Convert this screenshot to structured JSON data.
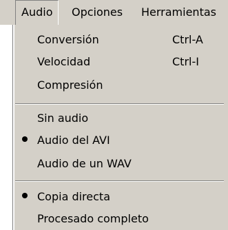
{
  "menubar": {
    "items": [
      {
        "label": "Audio",
        "active": true
      },
      {
        "label": "Opciones",
        "active": false
      },
      {
        "label": "Herramientas",
        "active": false
      }
    ]
  },
  "menu": {
    "conversion": {
      "label": "Conversión",
      "shortcut": "Ctrl-A"
    },
    "velocidad": {
      "label": "Velocidad",
      "shortcut": "Ctrl-I"
    },
    "compresion": {
      "label": "Compresión"
    },
    "sin_audio": {
      "label": "Sin audio",
      "checked": false
    },
    "audio_avi": {
      "label": "Audio del AVI",
      "checked": true
    },
    "audio_wav": {
      "label": "Audio de un WAV",
      "checked": false
    },
    "copia_directa": {
      "label": "Copia directa",
      "checked": true
    },
    "procesado_completo": {
      "label": "Procesado completo",
      "checked": false
    }
  },
  "colors": {
    "menu_background": "#d4d0c8",
    "shadow": "#808080",
    "highlight": "#ffffff"
  }
}
